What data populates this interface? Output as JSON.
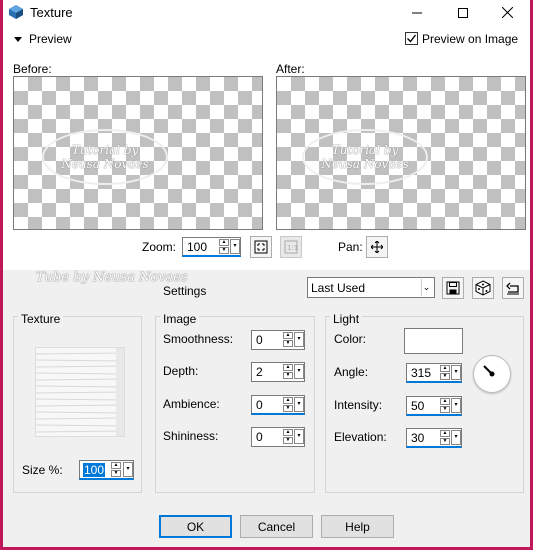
{
  "window": {
    "title": "Texture"
  },
  "preview": {
    "toggle_label": "Preview",
    "preview_on_image_label": "Preview on Image",
    "preview_on_image_checked": true,
    "before_label": "Before:",
    "after_label": "After:",
    "watermark_line1": "Tutorial by",
    "watermark_line2": "Neusa Novaes",
    "zoom_label": "Zoom:",
    "zoom_value": "100",
    "pan_label": "Pan:"
  },
  "settings": {
    "watermark_text": "Tube by Neusa Novaes",
    "label": "Settings",
    "preset_value": "Last Used"
  },
  "texture": {
    "group_label": "Texture",
    "size_label": "Size %:",
    "size_value": "100"
  },
  "image": {
    "group_label": "Image",
    "smoothness_label": "Smoothness:",
    "smoothness_value": "0",
    "depth_label": "Depth:",
    "depth_value": "2",
    "ambience_label": "Ambience:",
    "ambience_value": "0",
    "shininess_label": "Shininess:",
    "shininess_value": "0"
  },
  "light": {
    "group_label": "Light",
    "color_label": "Color:",
    "color_value": "#ffffff",
    "angle_label": "Angle:",
    "angle_value": "315",
    "intensity_label": "Intensity:",
    "intensity_value": "50",
    "elevation_label": "Elevation:",
    "elevation_value": "30"
  },
  "buttons": {
    "ok": "OK",
    "cancel": "Cancel",
    "help": "Help"
  },
  "colors": {
    "accent": "#0078d7",
    "window_border": "#c2185b"
  }
}
